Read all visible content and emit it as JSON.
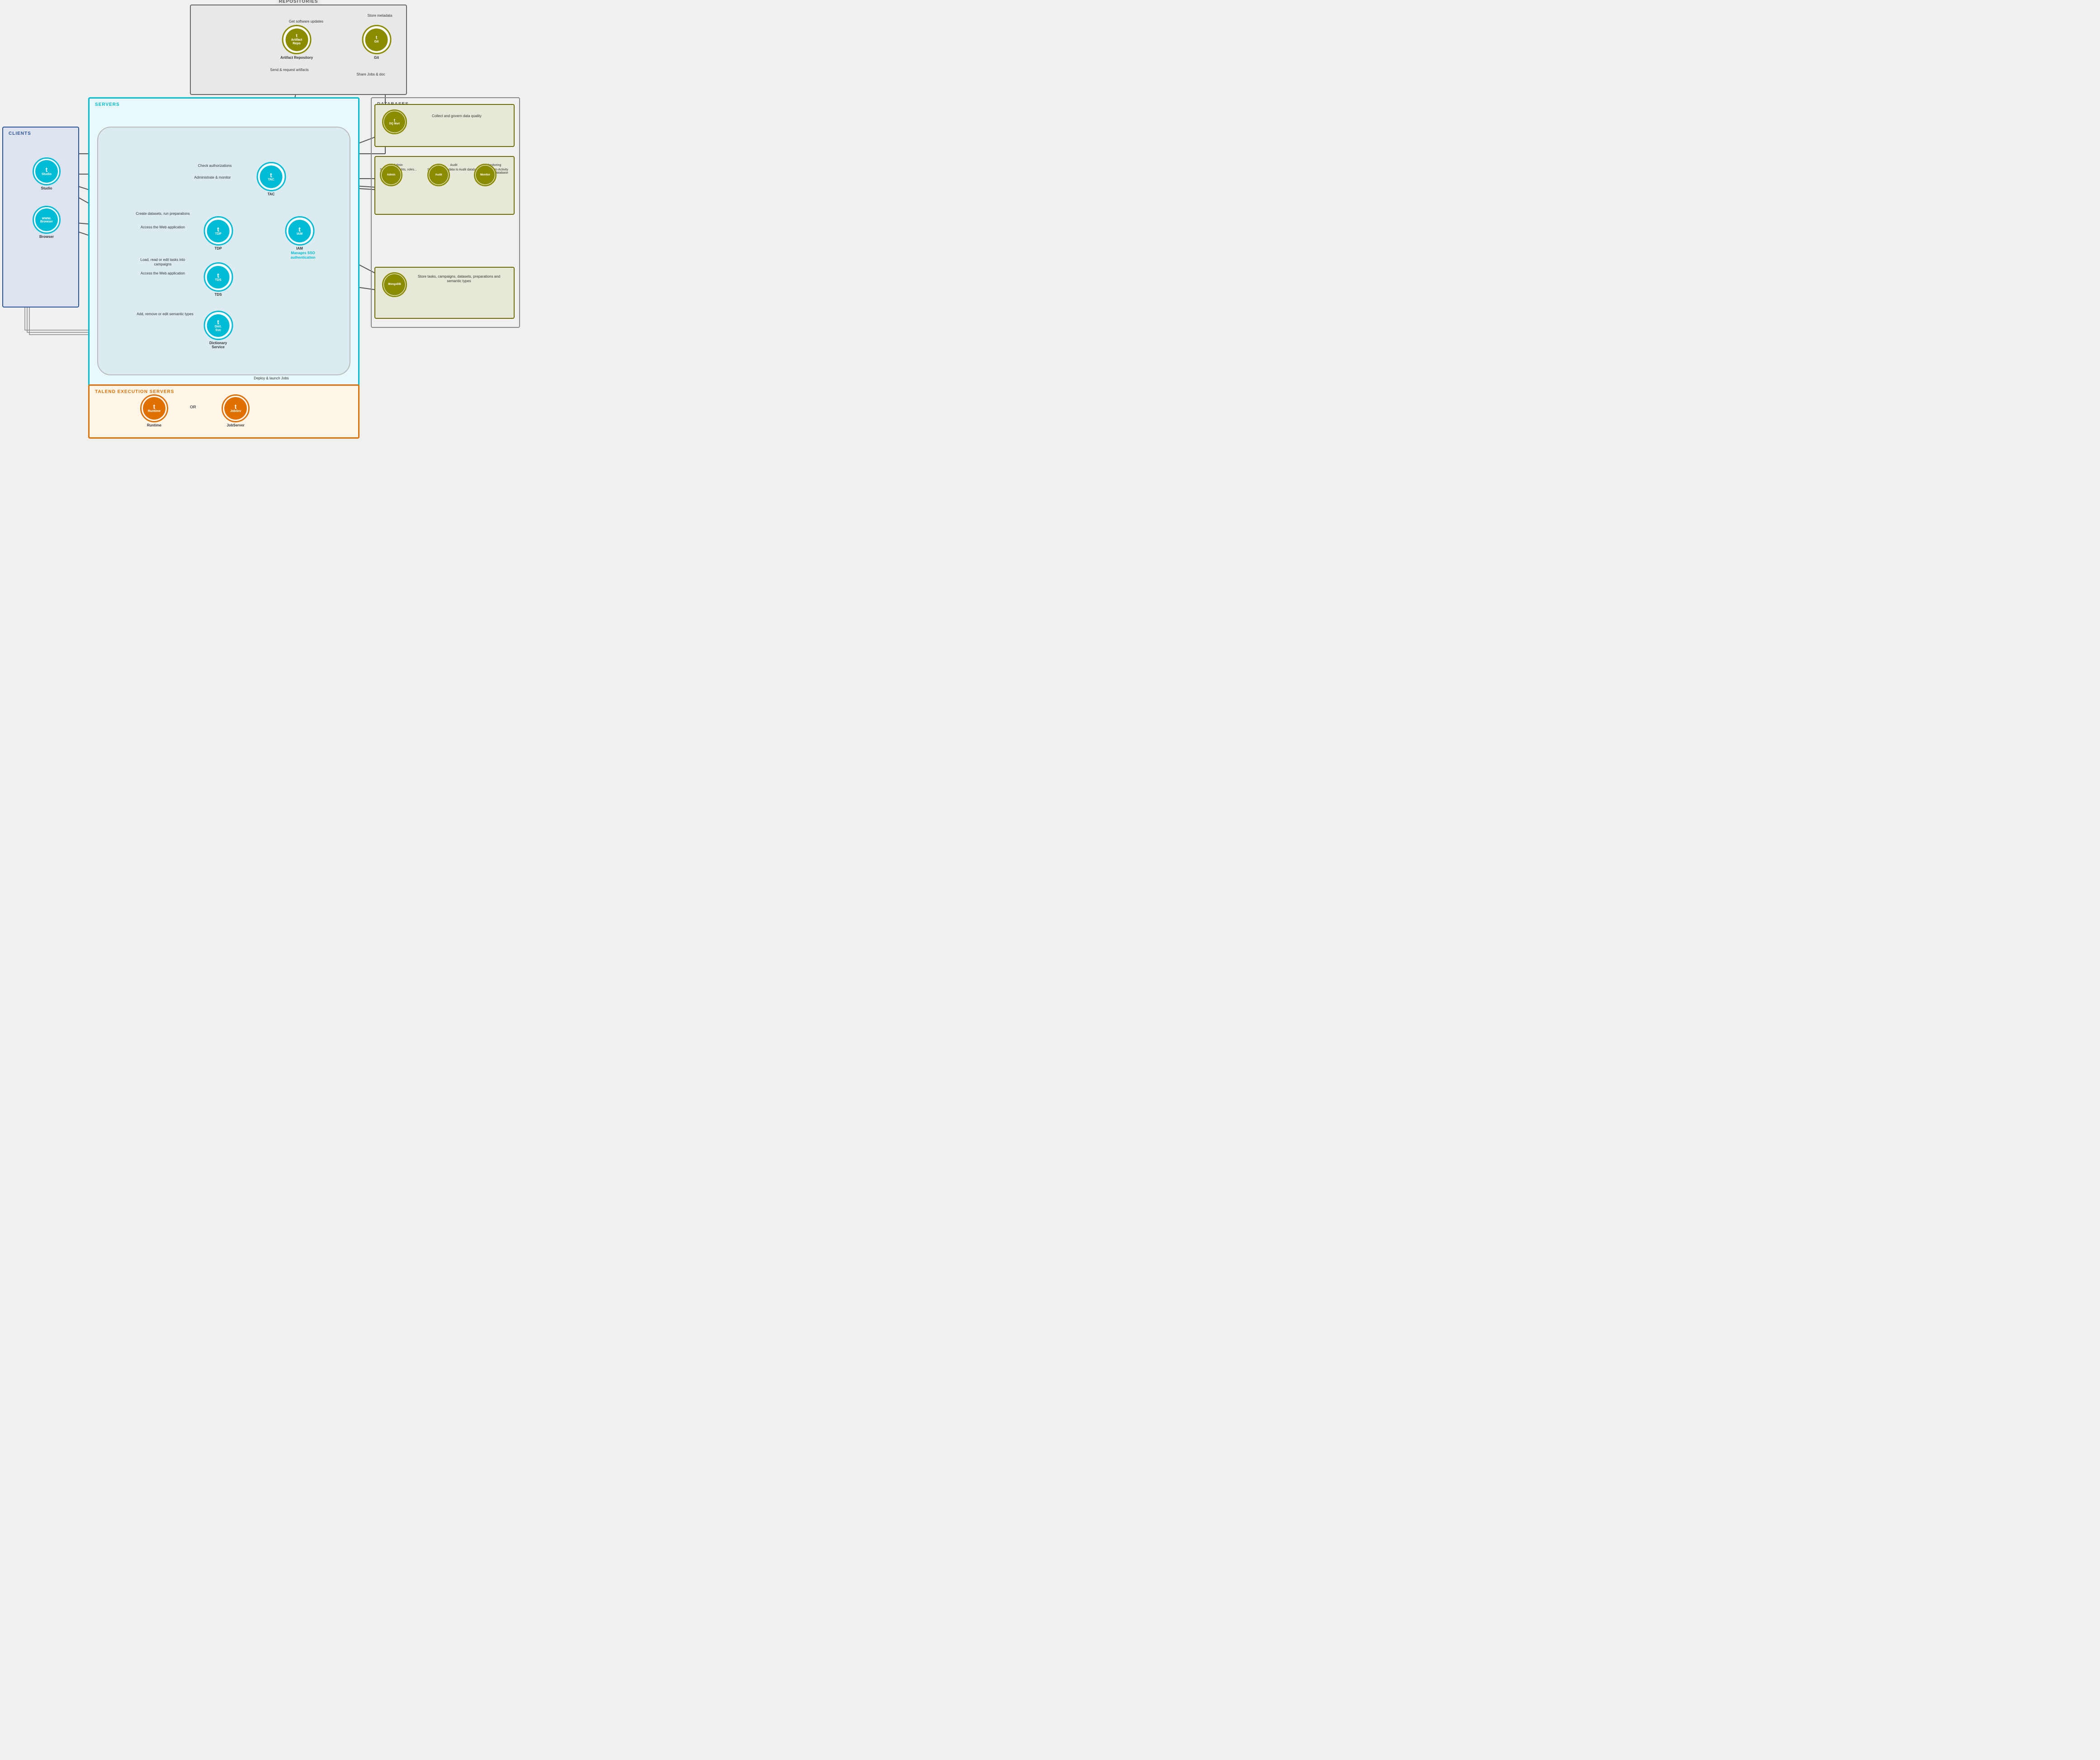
{
  "sections": {
    "repositories": {
      "label": "REPOSITORIES",
      "artifacts": {
        "name": "Artifact\nRepository",
        "get_updates": "Get software updates",
        "send_artifacts": "Send & request\nartifacts"
      },
      "git": {
        "name": "Git",
        "store_metadata": "Store\nmetadata",
        "share_jobs": "Share Jobs\n& doc"
      }
    },
    "clients": {
      "label": "CLIENTS",
      "studio": "Studio",
      "browser": "Browser"
    },
    "servers": {
      "label": "SERVERS",
      "tac": {
        "name": "TAC",
        "check_auth": "Check\nauthorizations",
        "admin_monitor": "Administrate\n& monitor"
      },
      "tdp": {
        "name": "TDP",
        "create_datasets": "Create datasets,\nrun preparations",
        "access_web": "Access the\nWeb application"
      },
      "iam": {
        "name": "IAM",
        "manages_sso": "Manages SSO\nauthentication"
      },
      "tds": {
        "name": "TDS",
        "load_tasks": "Load, read or edit\ntasks into campaigns",
        "access_web": "Access the\nWeb application"
      },
      "dictionary": {
        "name": "Dictionary\nService",
        "add_remove": "Add, remove or edit\nsemantic types"
      }
    },
    "databases": {
      "label": "DATABASES",
      "dq_mart": {
        "name": "DQ Mart",
        "description": "Collect and govern\ndata quality"
      },
      "admin": {
        "name": "Admin",
        "description": "Store users,\nrights, roles..."
      },
      "audit": {
        "name": "Audit",
        "description": "Send Job metadata\nto Audit database"
      },
      "monitoring": {
        "name": "Monitoring",
        "description": "Send data to Activity\nMonitoring database"
      },
      "mongodb": {
        "name": "MongoDB",
        "description": "Store tasks, campaigns,\ndatasets, preparations\nand semantic types"
      }
    },
    "execution": {
      "label": "TALEND EXECUTION SERVERS",
      "deploy_launch": "Deploy &\nlaunch Jobs",
      "runtime": "Runtime",
      "or": "OR",
      "jobserver": "JobServer"
    }
  }
}
